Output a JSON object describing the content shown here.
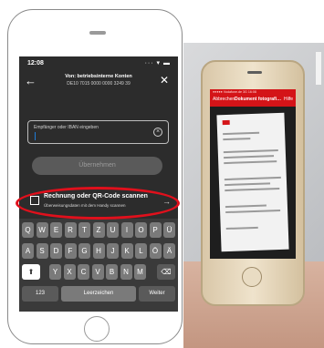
{
  "status_bar": {
    "time": "12:08",
    "icons": "··· ▾ ▬"
  },
  "header": {
    "title": "Von: betriebsinterne Konten",
    "subtitle": "DE10 7015 0000 0000 3249 39",
    "back_icon": "back-arrow-icon",
    "close_icon": "close-icon"
  },
  "iban_input": {
    "placeholder": "Empfänger oder IBAN eingeben",
    "value": "",
    "clear_icon": "clear-circle-icon"
  },
  "submit_button": {
    "label": "Übernehmen"
  },
  "scan_option": {
    "title": "Rechnung oder QR-Code scannen",
    "subtitle": "Überweisungsdaten mit dem Handy scannen",
    "icon": "qr-scan-icon",
    "arrow_icon": "arrow-right-icon"
  },
  "keyboard": {
    "row1": [
      "Q",
      "W",
      "E",
      "R",
      "T",
      "Z",
      "U",
      "I",
      "O",
      "P",
      "Ü"
    ],
    "row2": [
      "A",
      "S",
      "D",
      "F",
      "G",
      "H",
      "J",
      "K",
      "L",
      "Ö",
      "Ä"
    ],
    "row3": [
      "Y",
      "X",
      "C",
      "V",
      "B",
      "N",
      "M"
    ],
    "shift_icon": "shift-icon",
    "backspace_icon": "backspace-icon",
    "numbers_label": "123",
    "space_label": "Leerzeichen",
    "next_label": "Weiter"
  },
  "photo": {
    "statusline": "●●●●● Vodafone.de 3G   16:08",
    "cancel_label": "Abbrechen",
    "title": "Dokument fotografi…",
    "help_label": "Hilfe"
  },
  "colors": {
    "highlight": "#e0101c",
    "brand_red": "#d41418",
    "cursor": "#1f7bd6"
  }
}
